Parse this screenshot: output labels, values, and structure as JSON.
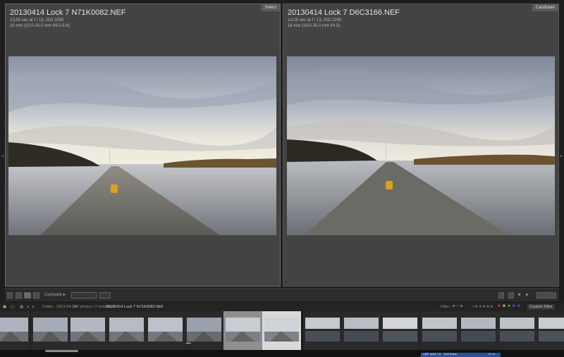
{
  "compare": {
    "select": {
      "tag": "Select",
      "filename": "20130414 Lock 7 N71K0082.NEF",
      "exposure": "1/125 sec at f / 13, ISO 2000",
      "lens": "10 mm (10.0-20.0 mm f/4.0-5.6)"
    },
    "candidate": {
      "tag": "Candidate",
      "filename": "20130414 Lock 7 D6C3166.NEF",
      "exposure": "1/125 sec at f / 13, ISO 2200",
      "lens": "16 mm (16.0-35.0 mm f/4.0)"
    }
  },
  "toolbar": {
    "compare_label": "Compare :",
    "lock_icon": "lock-icon",
    "colors": {
      "accent": "#c8a028"
    }
  },
  "filmbar": {
    "breadcrumb": "Folder : 2013-04-14",
    "count": "230 photos / 2 selected /",
    "current": "20130414 Lock 7 N71K0082.NEF",
    "filter_label": "Filter :",
    "filter_value": "Custom Filter"
  },
  "filmstrip": {
    "rating_dots": "•••••"
  },
  "status_strip": {
    "left": "XMP  delta 7.8",
    "middle": "Tool Notes",
    "right": "87 %"
  }
}
